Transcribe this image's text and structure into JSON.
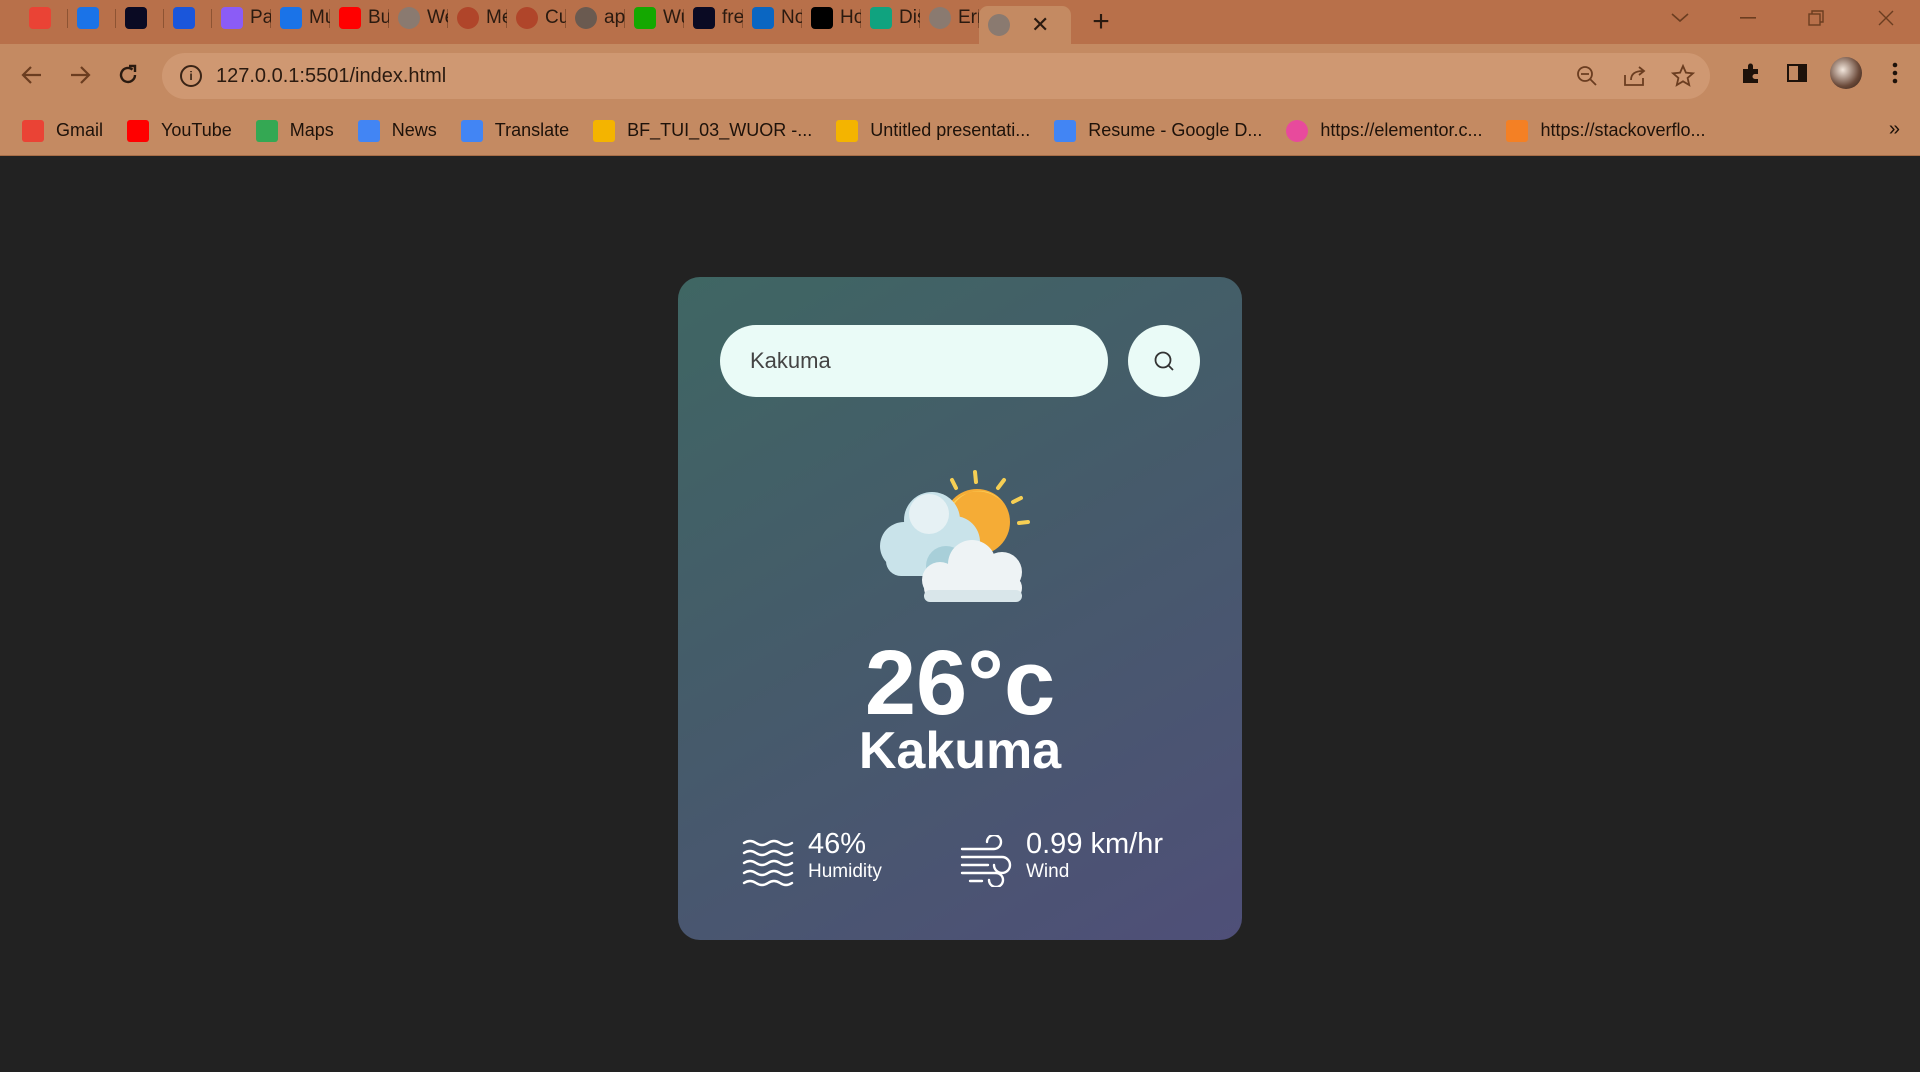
{
  "browser": {
    "tabs": [
      {
        "title": "",
        "icon": "gmail-icon",
        "color": "#ea4335"
      },
      {
        "title": "",
        "icon": "dsm-icon",
        "color": "#1a73e8"
      },
      {
        "title": "",
        "icon": "freecodecamp-icon",
        "color": "#0a0a23"
      },
      {
        "title": "",
        "icon": "c-app-icon",
        "color": "#1a56db"
      },
      {
        "title": "Pass",
        "icon": "pass-icon",
        "color": "#8b5cf6"
      },
      {
        "title": "Muf",
        "icon": "dsm-icon",
        "color": "#1a73e8"
      },
      {
        "title": "Buil",
        "icon": "youtube-icon",
        "color": "#ff0000"
      },
      {
        "title": "Wea",
        "icon": "globe-icon",
        "color": "#8a7a70"
      },
      {
        "title": "Mer",
        "icon": "globe-icon",
        "color": "#b0452a"
      },
      {
        "title": "Curr",
        "icon": "globe-icon",
        "color": "#b0452a"
      },
      {
        "title": "api.",
        "icon": "globe-icon",
        "color": "#6a5a50"
      },
      {
        "title": "Wu",
        "icon": "upwork-icon",
        "color": "#14a800"
      },
      {
        "title": "free",
        "icon": "freecodecamp-icon",
        "color": "#0a0a23"
      },
      {
        "title": "Not",
        "icon": "linkedin-icon",
        "color": "#0a66c2"
      },
      {
        "title": "Hor",
        "icon": "x-icon",
        "color": "#000000"
      },
      {
        "title": "Disp",
        "icon": "openai-icon",
        "color": "#10a37f"
      },
      {
        "title": "Erro",
        "icon": "globe-icon",
        "color": "#8a7a70"
      }
    ],
    "active_tab_icon": "globe-icon",
    "address": "127.0.0.1:5501/index.html",
    "bookmarks": [
      {
        "label": "Gmail",
        "icon": "gmail-icon",
        "color": "#ea4335"
      },
      {
        "label": "YouTube",
        "icon": "youtube-icon",
        "color": "#ff0000"
      },
      {
        "label": "Maps",
        "icon": "maps-icon",
        "color": "#34a853"
      },
      {
        "label": "News",
        "icon": "news-icon",
        "color": "#4285f4"
      },
      {
        "label": "Translate",
        "icon": "translate-icon",
        "color": "#4285f4"
      },
      {
        "label": "BF_TUI_03_WUOR -...",
        "icon": "slides-icon",
        "color": "#f4b400"
      },
      {
        "label": "Untitled presentati...",
        "icon": "slides-icon",
        "color": "#f4b400"
      },
      {
        "label": "Resume - Google D...",
        "icon": "docs-icon",
        "color": "#4285f4"
      },
      {
        "label": "https://elementor.c...",
        "icon": "elementor-icon",
        "color": "#e84a9c"
      },
      {
        "label": "https://stackoverflo...",
        "icon": "stackoverflow-icon",
        "color": "#f48024"
      }
    ],
    "bookmarks_more": "»"
  },
  "weather": {
    "search_value": "Kakuma",
    "temperature": "26°c",
    "city": "Kakuma",
    "humidity": {
      "value": "46%",
      "label": "Humidity"
    },
    "wind": {
      "value": "0.99 km/hr",
      "label": "Wind"
    }
  }
}
